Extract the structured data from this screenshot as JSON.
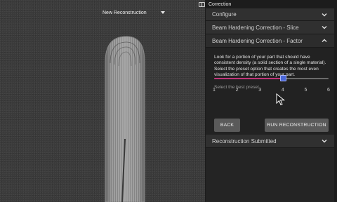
{
  "window": {
    "title": "Correction"
  },
  "viewer": {
    "reconstruction_label": "New Reconstruction"
  },
  "panel": {
    "sections": {
      "configure": "Configure",
      "slice": "Beam Hardening Correction - Slice",
      "factor": "Beam Hardening Correction - Factor",
      "submitted": "Reconstruction Submitted"
    },
    "factor": {
      "instructions": "Look for a portion of your part that should have consistent density (a solid section of a single material). Select the preset option that creates the most even visualization of that portion of your part.",
      "hint": "Select the best preset.",
      "slider": {
        "min": 1,
        "max": 6,
        "value": 4.0
      },
      "tick_labels": [
        "1",
        "2",
        "3",
        "4",
        "5",
        "6"
      ],
      "back_label": "BACK",
      "run_label": "RUN RECONSTRUCTION"
    }
  },
  "colors": {
    "slider_fill": "#c0357a",
    "slider_handle": "#4a67d8",
    "button_bg": "#5a5a5a"
  },
  "icons": {
    "layout": "layout-toggle-icon",
    "collapse": "chevron-down-icon",
    "expand": "chevron-up-icon",
    "dropdown": "caret-down-icon",
    "pointer": "mouse-pointer-icon"
  }
}
